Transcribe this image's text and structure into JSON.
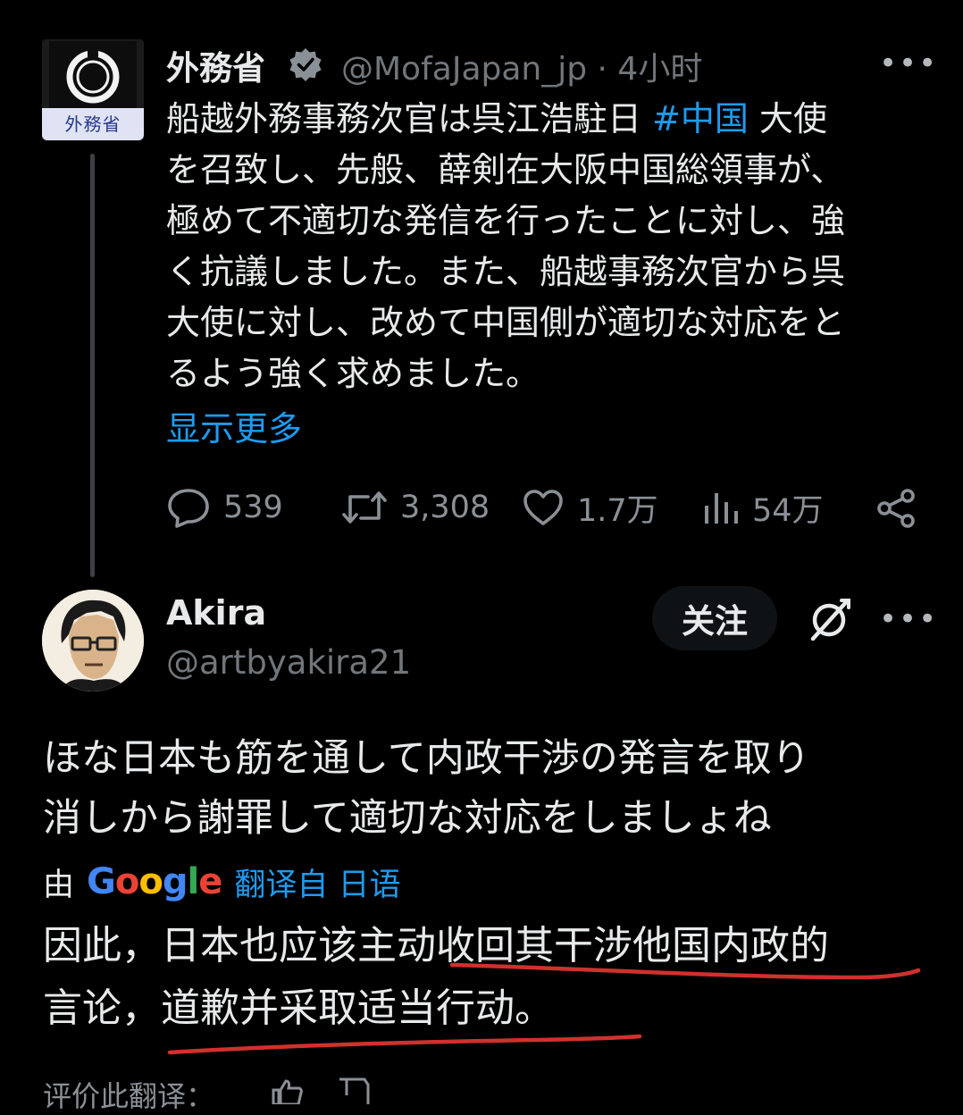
{
  "tweet1": {
    "avatar_text": "外務省",
    "name": "外務省",
    "handle_time": "@MofaJapan_jp · 4小时",
    "body_lines": [
      {
        "pre": "船越外務事務次官は呉江浩駐日 ",
        "tag": "#中国",
        "post": " 大使"
      },
      {
        "pre": "を召致し、先般、薛剣在大阪中国総領事が、",
        "tag": "",
        "post": ""
      },
      {
        "pre": "極めて不適切な発信を行ったことに対し、強",
        "tag": "",
        "post": ""
      },
      {
        "pre": "く抗議しました。また、船越事務次官から呉",
        "tag": "",
        "post": ""
      },
      {
        "pre": "大使に対し、改めて中国側が適切な対応をと",
        "tag": "",
        "post": ""
      },
      {
        "pre": "るよう強く求めました。",
        "tag": "",
        "post": ""
      }
    ],
    "show_more": "显示更多",
    "actions": {
      "replies": "539",
      "retweets": "3,308",
      "likes": "1.7万",
      "views": "54万"
    }
  },
  "tweet2": {
    "name": "Akira",
    "handle": "@artbyakira21",
    "follow_label": "关注",
    "body_lines": [
      "ほな日本も筋を通して内政干渉の発言を取り",
      "消しから謝罪して適切な対応をしましょね"
    ],
    "translated_prefix": "由",
    "google_letters": [
      "G",
      "o",
      "o",
      "g",
      "l",
      "e"
    ],
    "google_colors": [
      "#4285f4",
      "#ea4335",
      "#fbbc05",
      "#4285f4",
      "#34a853",
      "#ea4335"
    ],
    "translated_from": "翻译自 日语",
    "translation_lines": [
      "因此，日本也应该主动收回其干涉他国内政的",
      "言论，道歉并采取适当行动。"
    ],
    "rate_label": "评价此翻译："
  },
  "colors": {
    "background": "#000000",
    "text": "#e7e9ea",
    "muted": "#71767b",
    "link": "#1d9bf0",
    "annotation": "#d0312d"
  },
  "icons": [
    "verified-badge-icon",
    "more-icon",
    "reply-icon",
    "retweet-icon",
    "like-icon",
    "views-icon",
    "share-icon",
    "grok-icon",
    "thumbs-up-icon",
    "thumbs-down-icon"
  ]
}
